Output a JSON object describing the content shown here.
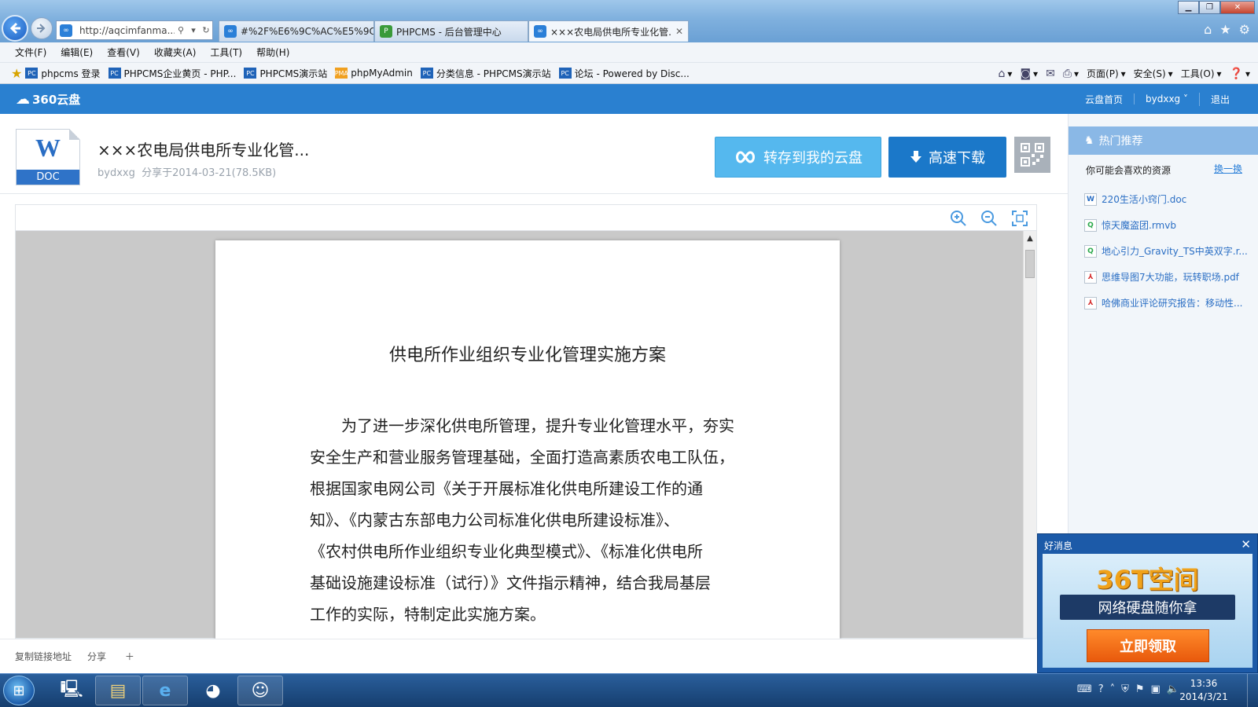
{
  "browser": {
    "address_url": "http://aqcimfanma....",
    "tabs": [
      {
        "label": "#%2F%E6%9C%AC%E5%9C...",
        "icon": "360-icon"
      },
      {
        "label": "PHPCMS - 后台管理中心",
        "icon": "phpcms-icon"
      },
      {
        "label": "×××农电局供电所专业化管...",
        "icon": "360-icon"
      }
    ],
    "menu": [
      "文件(F)",
      "编辑(E)",
      "查看(V)",
      "收藏夹(A)",
      "工具(T)",
      "帮助(H)"
    ],
    "favorites": [
      "phpcms 登录",
      "PHPCMS企业黄页 - PHP...",
      "PHPCMS演示站",
      "phpMyAdmin",
      "分类信息 - PHPCMS演示站",
      "论坛 - Powered by Disc..."
    ],
    "command_bar": [
      "页面(P)",
      "安全(S)",
      "工具(O)"
    ]
  },
  "yunpan": {
    "logo": "360云盘",
    "nav": [
      "云盘首页",
      "bydxxg",
      "退出"
    ]
  },
  "file": {
    "badge": "DOC",
    "title": "×××农电局供电所专业化管...",
    "owner": "bydxxg",
    "meta": "分享于2014-03-21(78.5KB)",
    "save_label": "转存到我的云盘",
    "download_label": "高速下载"
  },
  "document": {
    "heading": "供电所作业组织专业化管理实施方案",
    "lines": [
      "　　为了进一步深化供电所管理，提升专业化管理水平，夯实",
      "安全生产和营业服务管理基础，全面打造高素质农电工队伍，",
      "根据国家电网公司《关于开展标准化供电所建设工作的通",
      "知》、《内蒙古东部电力公司标准化供电所建设标准》、",
      "《农村供电所作业组织专业化典型模式》、《标准化供电所",
      "基础设施建设标准（试行）》文件指示精神，结合我局基层",
      "工作的实际，特制定此实施方案。"
    ]
  },
  "share_bar": {
    "copy_link": "复制链接地址",
    "share": "分享"
  },
  "sidebar": {
    "hot_title": "热门推荐",
    "like_title": "你可能会喜欢的资源",
    "refresh": "换一换",
    "items": [
      {
        "name": "220生活小窍门.doc",
        "type": "doc"
      },
      {
        "name": "惊天魔盗团.rmvb",
        "type": "video"
      },
      {
        "name": "地心引力_Gravity_TS中英双字.r...",
        "type": "video"
      },
      {
        "name": "思维导图7大功能，玩转职场.pdf",
        "type": "pdf"
      },
      {
        "name": "哈佛商业评论研究报告：移动性...",
        "type": "pdf"
      }
    ]
  },
  "ad": {
    "header": "好消息",
    "headline": "36T空间",
    "ribbon": "网络硬盘随你拿",
    "cta": "立即领取"
  },
  "taskbar": {
    "time": "13:36",
    "date": "2014/3/21"
  },
  "colors": {
    "yunpan_blue": "#2a80d0",
    "save_button": "#55b8ee",
    "download_button": "#1b78c9",
    "hot_header": "#8ab8e6",
    "ad_cta": "#e8590c"
  }
}
